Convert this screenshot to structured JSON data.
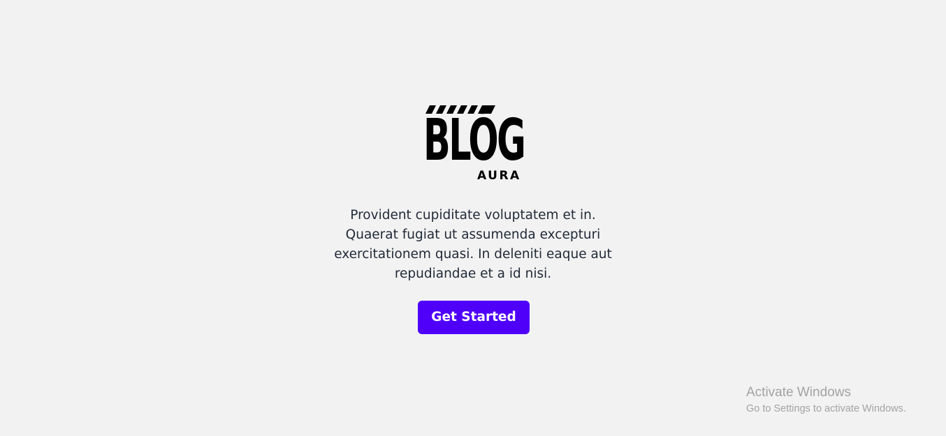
{
  "logo": {
    "word": "BLÓG",
    "sub": "AURA",
    "color": "#000000"
  },
  "hero": {
    "description": "Provident cupiditate voluptatem et in. Quaerat fugiat ut assumenda excepturi exercitationem quasi. In deleniti eaque aut repudiandae et a id nisi.",
    "cta_label": "Get Started",
    "cta_color": "#4f00f9"
  },
  "watermark": {
    "title": "Activate Windows",
    "subtitle": "Go to Settings to activate Windows."
  },
  "colors": {
    "background": "#f2f2f2",
    "text": "#1f2937",
    "watermark": "#a3a3a3"
  }
}
